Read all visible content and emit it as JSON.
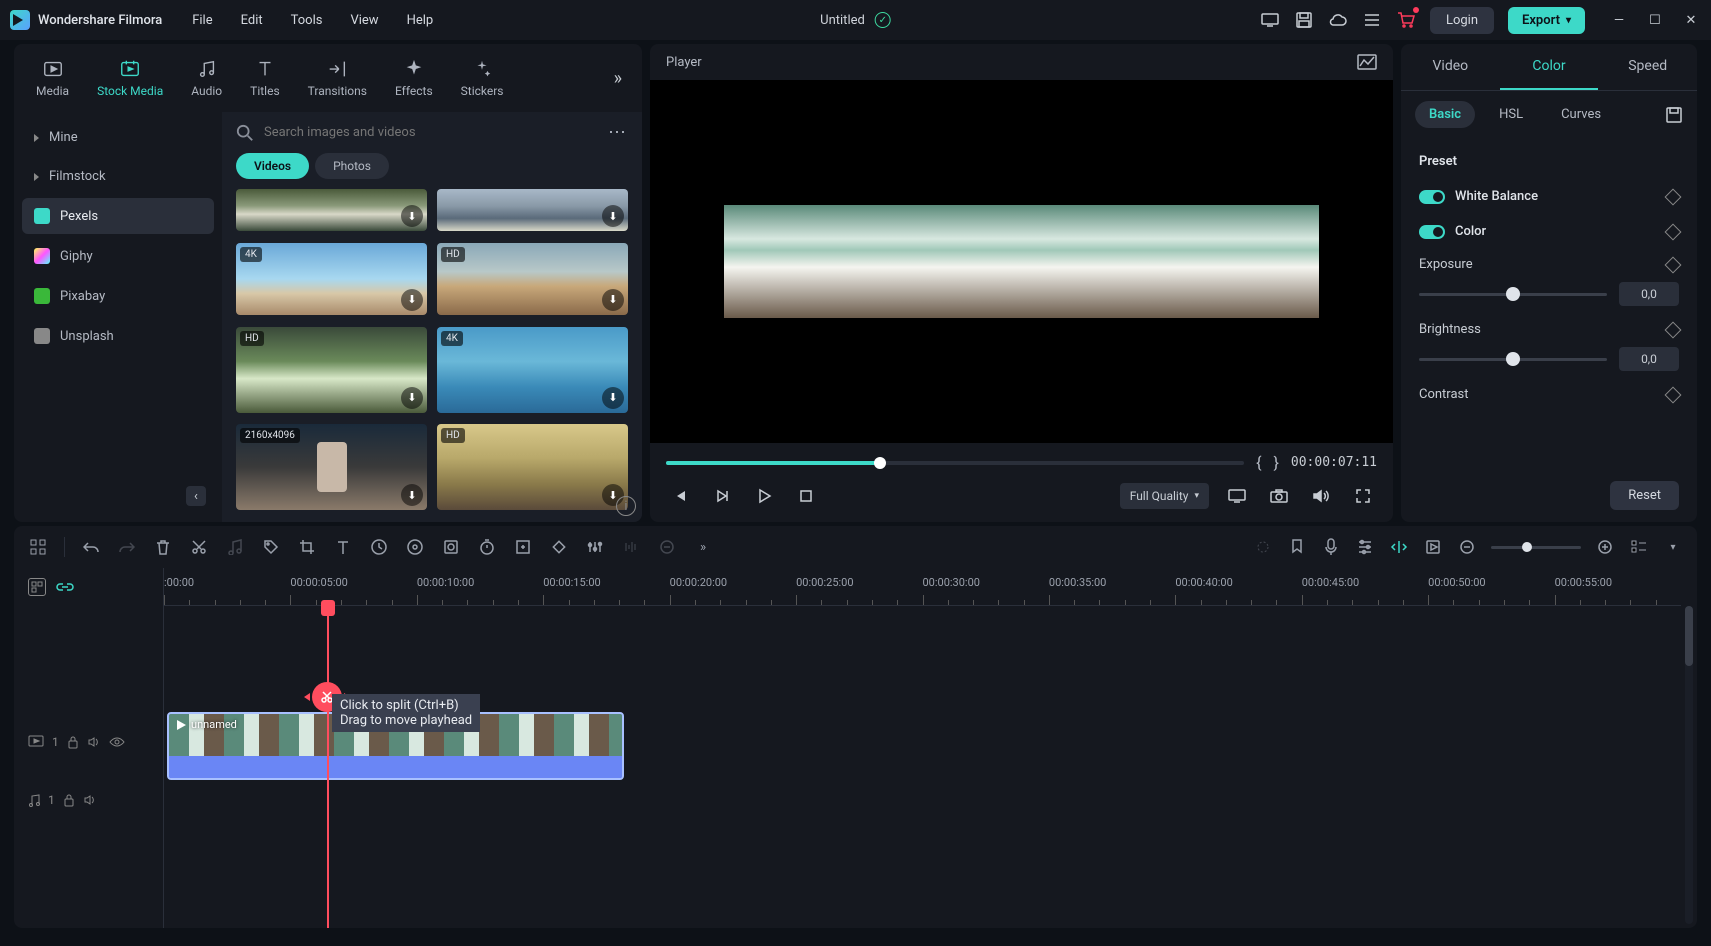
{
  "app_name": "Wondershare Filmora",
  "menu": {
    "file": "File",
    "edit": "Edit",
    "tools": "Tools",
    "view": "View",
    "help": "Help"
  },
  "title": "Untitled",
  "login": "Login",
  "export": "Export",
  "categories": [
    {
      "id": "media",
      "label": "Media"
    },
    {
      "id": "stock",
      "label": "Stock Media"
    },
    {
      "id": "audio",
      "label": "Audio"
    },
    {
      "id": "titles",
      "label": "Titles"
    },
    {
      "id": "transitions",
      "label": "Transitions"
    },
    {
      "id": "effects",
      "label": "Effects"
    },
    {
      "id": "stickers",
      "label": "Stickers"
    }
  ],
  "sources": [
    {
      "label": "Mine",
      "color": "#666"
    },
    {
      "label": "Filmstock",
      "color": "#666"
    },
    {
      "label": "Pexels",
      "color": "#3dd9c8"
    },
    {
      "label": "Giphy",
      "color": "linear-gradient(135deg,#ff5,#f5f,#5ff)"
    },
    {
      "label": "Pixabay",
      "color": "#3ab83a"
    },
    {
      "label": "Unsplash",
      "color": "#888"
    }
  ],
  "search_placeholder": "Search images and videos",
  "filter": {
    "videos": "Videos",
    "photos": "Photos"
  },
  "thumbs": [
    {
      "badge": "",
      "bg": "bg1"
    },
    {
      "badge": "",
      "bg": "bg2"
    },
    {
      "badge": "4K",
      "bg": "bg3"
    },
    {
      "badge": "HD",
      "bg": "bg4"
    },
    {
      "badge": "HD",
      "bg": "bg5"
    },
    {
      "badge": "4K",
      "bg": "bg6"
    },
    {
      "badge": "2160x4096",
      "bg": "bg7"
    },
    {
      "badge": "HD",
      "bg": "bg8"
    }
  ],
  "player": {
    "title": "Player",
    "quality": "Full Quality",
    "time": "00:00:07:11"
  },
  "right": {
    "tabs": {
      "video": "Video",
      "color": "Color",
      "speed": "Speed"
    },
    "sub": {
      "basic": "Basic",
      "hsl": "HSL",
      "curves": "Curves"
    },
    "preset": "Preset",
    "white_balance": "White Balance",
    "color": "Color",
    "exposure": "Exposure",
    "exposure_val": "0,0",
    "brightness": "Brightness",
    "brightness_val": "0,0",
    "contrast": "Contrast",
    "reset": "Reset"
  },
  "ruler": [
    ":00:00",
    "00:00:05:00",
    "00:00:10:00",
    "00:00:15:00",
    "00:00:20:00",
    "00:00:25:00",
    "00:00:30:00",
    "00:00:35:00",
    "00:00:40:00",
    "00:00:45:00",
    "00:00:50:00",
    "00:00:55:00"
  ],
  "clip_name": "unnamed",
  "tooltip_line1": "Click to split (Ctrl+B)",
  "tooltip_line2": "Drag to move playhead",
  "track_video": "1",
  "track_audio": "1"
}
